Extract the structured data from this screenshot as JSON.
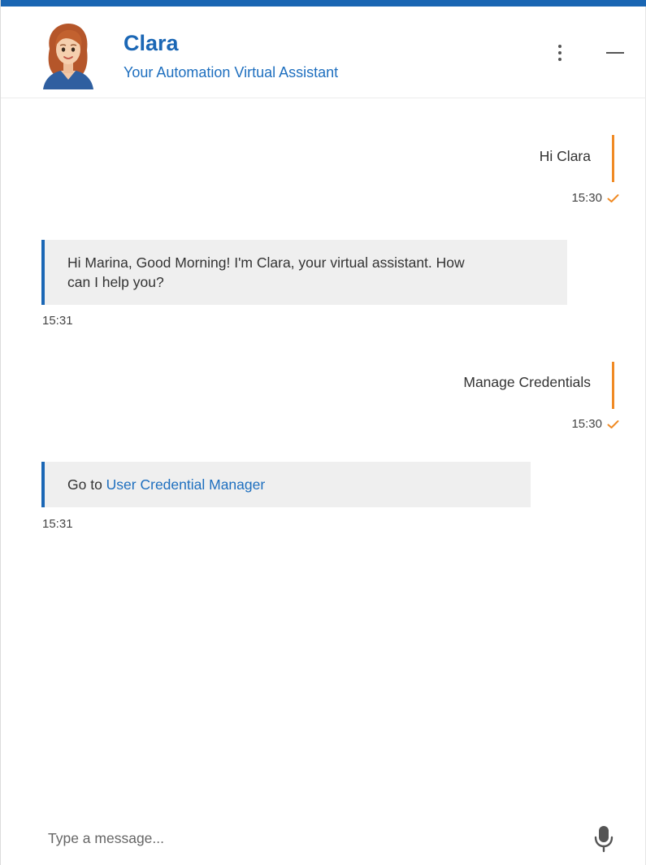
{
  "header": {
    "bot_name": "Clara",
    "bot_subtitle": "Your Automation Virtual Assistant",
    "avatar_icon": "woman-avatar-icon",
    "menu_icon": "vertical-dots-icon",
    "minimize_icon": "minimize-icon"
  },
  "messages": [
    {
      "sender": "user",
      "text": "Hi Clara",
      "time": "15:30",
      "status_icon": "check-icon"
    },
    {
      "sender": "bot",
      "text_lines": [
        "Hi Marina, Good Morning! I'm Clara, your virtual assistant. How",
        "can I help you?"
      ],
      "time": "15:31"
    },
    {
      "sender": "user",
      "text": "Manage Credentials",
      "time": "15:30",
      "status_icon": "check-icon"
    },
    {
      "sender": "bot",
      "prefix": "Go to ",
      "link_text": "User Credential Manager",
      "time": "15:31"
    }
  ],
  "composer": {
    "placeholder": "Type a message...",
    "mic_icon": "microphone-icon"
  },
  "colors": {
    "brand_blue": "#1b67b5",
    "link_blue": "#1e6fbf",
    "user_accent": "#f08a24",
    "bot_bubble": "#efefef"
  }
}
